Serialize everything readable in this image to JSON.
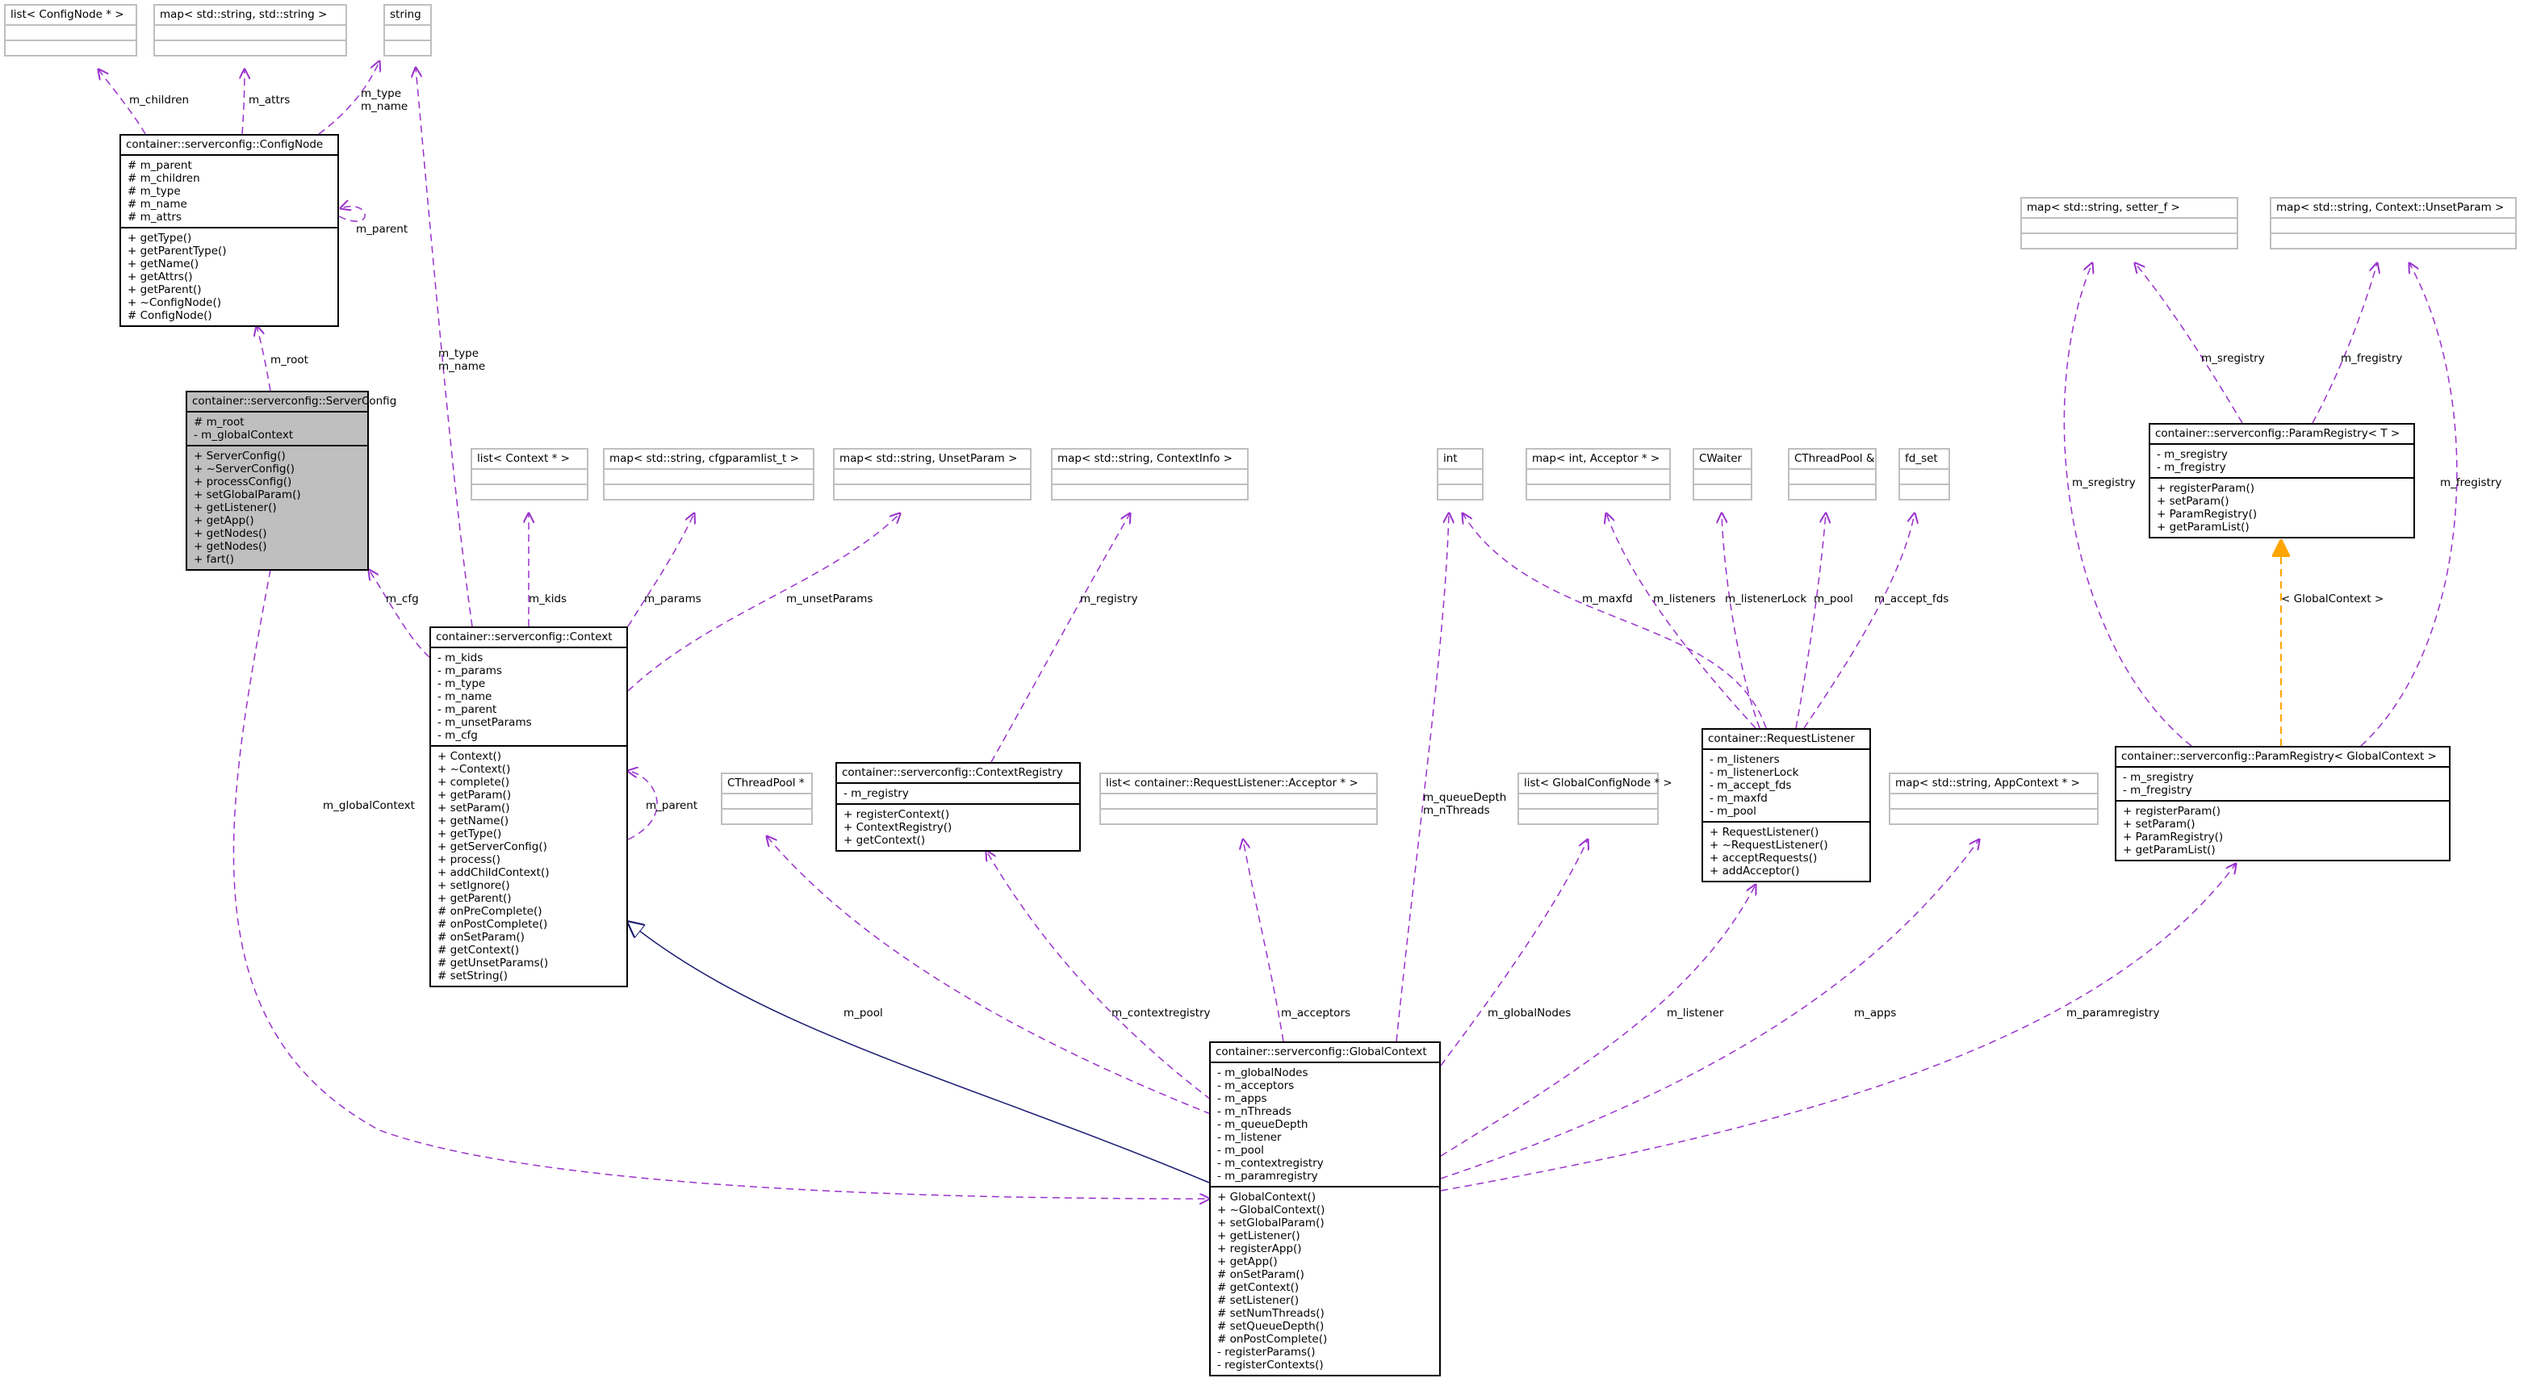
{
  "colors": {
    "dependency": "#9a32cd",
    "inheritance": "#191970",
    "template": "#ffa500",
    "ghost_border": "#bfbfbf",
    "highlight_fill": "#bfbfbf"
  },
  "nodes": {
    "list_confignode": {
      "title": "list< ConfigNode * >",
      "ghost": true,
      "attrs": [],
      "ops": []
    },
    "map_string_string": {
      "title": "map< std::string, std::string >",
      "ghost": true,
      "attrs": [],
      "ops": []
    },
    "string": {
      "title": "string",
      "ghost": true,
      "attrs": [],
      "ops": []
    },
    "confignode": {
      "title": "container::serverconfig::ConfigNode",
      "attrs": [
        "# m_parent",
        "# m_children",
        "# m_type",
        "# m_name",
        "# m_attrs"
      ],
      "ops": [
        "+ getType()",
        "+ getParentType()",
        "+ getName()",
        "+ getAttrs()",
        "+ getParent()",
        "+ ~ConfigNode()",
        "# ConfigNode()"
      ]
    },
    "serverconfig": {
      "title": "container::serverconfig::ServerConfig",
      "highlight": true,
      "attrs": [
        "# m_root",
        "- m_globalContext"
      ],
      "ops": [
        "+ ServerConfig()",
        "+ ~ServerConfig()",
        "+ processConfig()",
        "+ setGlobalParam()",
        "+ getListener()",
        "+ getApp()",
        "+ getNodes()",
        "+ getNodes()",
        "+ fart()"
      ]
    },
    "list_context": {
      "title": "list< Context * >",
      "ghost": true,
      "attrs": [],
      "ops": []
    },
    "map_cfgparamlist": {
      "title": "map< std::string, cfgparamlist_t >",
      "ghost": true,
      "attrs": [],
      "ops": []
    },
    "map_unsetparam": {
      "title": "map< std::string, UnsetParam >",
      "ghost": true,
      "attrs": [],
      "ops": []
    },
    "map_contextinfo": {
      "title": "map< std::string, ContextInfo >",
      "ghost": true,
      "attrs": [],
      "ops": []
    },
    "context": {
      "title": "container::serverconfig::Context",
      "attrs": [
        "- m_kids",
        "- m_params",
        "- m_type",
        "- m_name",
        "- m_parent",
        "- m_unsetParams",
        "- m_cfg"
      ],
      "ops": [
        "+ Context()",
        "+ ~Context()",
        "+ complete()",
        "+ getParam()",
        "+ setParam()",
        "+ getName()",
        "+ getType()",
        "+ getServerConfig()",
        "+ process()",
        "+ addChildContext()",
        "+ setIgnore()",
        "+ getParent()",
        "# onPreComplete()",
        "# onPostComplete()",
        "# onSetParam()",
        "# getContext()",
        "# getUnsetParams()",
        "# setString()"
      ]
    },
    "cthreadpool_ptr": {
      "title": "CThreadPool *",
      "ghost": true,
      "attrs": [],
      "ops": []
    },
    "contextregistry": {
      "title": "container::serverconfig::ContextRegistry",
      "attrs": [
        "- m_registry"
      ],
      "ops": [
        "+ registerContext()",
        "+ ContextRegistry()",
        "+ getContext()"
      ]
    },
    "list_acceptor": {
      "title": "list< container::RequestListener::Acceptor * >",
      "ghost": true,
      "attrs": [],
      "ops": []
    },
    "int": {
      "title": "int",
      "ghost": true,
      "attrs": [],
      "ops": []
    },
    "map_int_acceptor": {
      "title": "map< int, Acceptor * >",
      "ghost": true,
      "attrs": [],
      "ops": []
    },
    "cwaiter": {
      "title": "CWaiter",
      "ghost": true,
      "attrs": [],
      "ops": []
    },
    "cthreadpool_ref": {
      "title": "CThreadPool &",
      "ghost": true,
      "attrs": [],
      "ops": []
    },
    "fd_set": {
      "title": "fd_set",
      "ghost": true,
      "attrs": [],
      "ops": []
    },
    "list_globalconfignode": {
      "title": "list< GlobalConfigNode * >",
      "ghost": true,
      "attrs": [],
      "ops": []
    },
    "requestlistener": {
      "title": "container::RequestListener",
      "attrs": [
        "- m_listeners",
        "- m_listenerLock",
        "- m_accept_fds",
        "- m_maxfd",
        "- m_pool"
      ],
      "ops": [
        "+ RequestListener()",
        "+ ~RequestListener()",
        "+ acceptRequests()",
        "+ addAcceptor()"
      ]
    },
    "map_appcontext": {
      "title": "map< std::string, AppContext * >",
      "ghost": true,
      "attrs": [],
      "ops": []
    },
    "map_setter": {
      "title": "map< std::string, setter_f >",
      "ghost": true,
      "attrs": [],
      "ops": []
    },
    "map_ctx_unsetparam": {
      "title": "map< std::string, Context::UnsetParam >",
      "ghost": true,
      "attrs": [],
      "ops": []
    },
    "paramregistry_t": {
      "title": "container::serverconfig::ParamRegistry< T >",
      "attrs": [
        "- m_sregistry",
        "- m_fregistry"
      ],
      "ops": [
        "+ registerParam()",
        "+ setParam()",
        "+ ParamRegistry()",
        "+ getParamList()"
      ]
    },
    "paramregistry_gc": {
      "title": "container::serverconfig::ParamRegistry< GlobalContext >",
      "attrs": [
        "- m_sregistry",
        "- m_fregistry"
      ],
      "ops": [
        "+ registerParam()",
        "+ setParam()",
        "+ ParamRegistry()",
        "+ getParamList()"
      ]
    },
    "globalcontext": {
      "title": "container::serverconfig::GlobalContext",
      "attrs": [
        "- m_globalNodes",
        "- m_acceptors",
        "- m_apps",
        "- m_nThreads",
        "- m_queueDepth",
        "- m_listener",
        "- m_pool",
        "- m_contextregistry",
        "- m_paramregistry"
      ],
      "ops": [
        "+ GlobalContext()",
        "+ ~GlobalContext()",
        "+ setGlobalParam()",
        "+ getListener()",
        "+ registerApp()",
        "+ getApp()",
        "# onSetParam()",
        "# getContext()",
        "# setListener()",
        "# setNumThreads()",
        "# setQueueDepth()",
        "# onPostComplete()",
        "- registerParams()",
        "- registerContexts()"
      ]
    }
  },
  "edge_labels": {
    "m_children": "m_children",
    "m_attrs": "m_attrs",
    "m_type_name_cn": "m_type\nm_name",
    "m_parent_cn": "m_parent",
    "m_root": "m_root",
    "m_type_name_ctx": "m_type\nm_name",
    "m_cfg": "m_cfg",
    "m_kids": "m_kids",
    "m_params": "m_params",
    "m_unsetParams": "m_unsetParams",
    "m_registry": "m_registry",
    "m_parent_ctx": "m_parent",
    "m_globalContext": "m_globalContext",
    "m_maxfd": "m_maxfd",
    "m_listeners": "m_listeners",
    "m_listenerLock": "m_listenerLock",
    "m_pool_rl": "m_pool",
    "m_accept_fds": "m_accept_fds",
    "m_queueDepth_nThreads": "m_queueDepth\nm_nThreads",
    "m_sregistry_t": "m_sregistry",
    "m_fregistry_t": "m_fregistry",
    "m_sregistry_gc": "m_sregistry",
    "m_fregistry_gc": "m_fregistry",
    "template_binding": "< GlobalContext >",
    "m_pool_gc": "m_pool",
    "m_contextregistry": "m_contextregistry",
    "m_acceptors": "m_acceptors",
    "m_globalNodes": "m_globalNodes",
    "m_listener": "m_listener",
    "m_apps": "m_apps",
    "m_paramregistry": "m_paramregistry"
  }
}
